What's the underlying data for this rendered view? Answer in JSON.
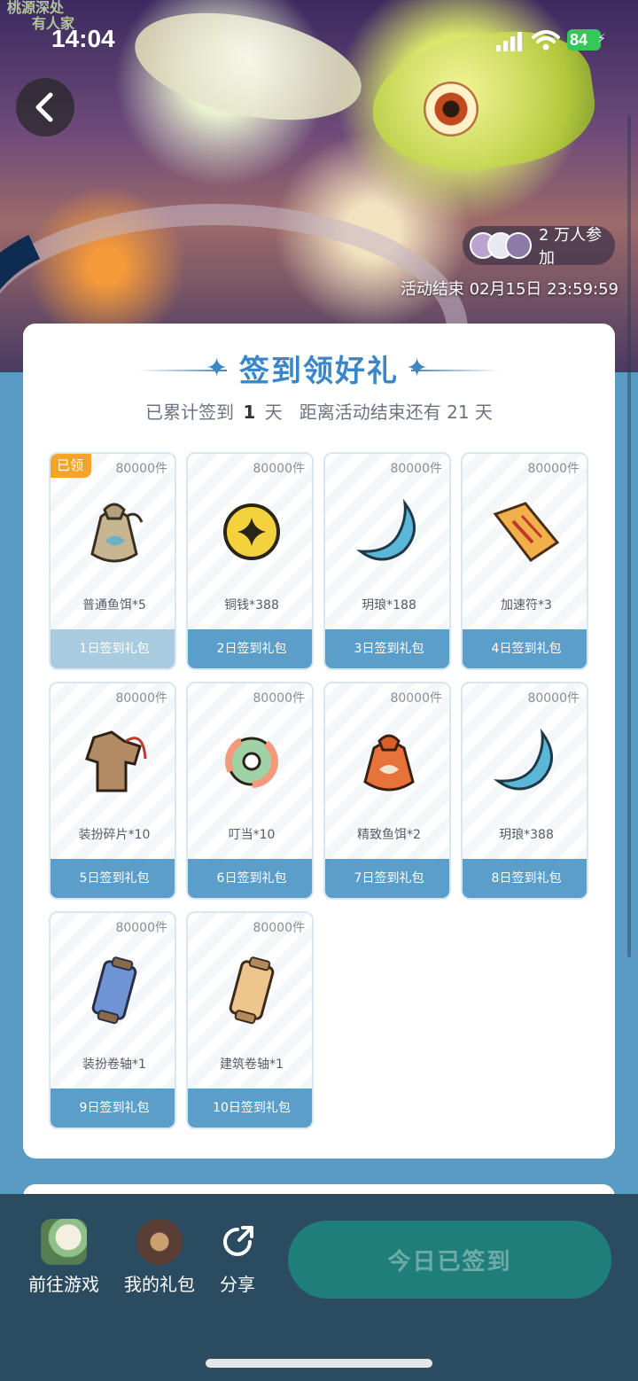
{
  "status_bar": {
    "time": "14:04",
    "battery": "84"
  },
  "hero": {
    "corner_text_line1": "桃源深处",
    "corner_text_line2": "有人家",
    "participants": "2 万人参加",
    "end_time": "活动结束 02月15日 23:59:59"
  },
  "card": {
    "title": "签到领好礼",
    "subtitle_prefix": "已累计签到",
    "subtitle_days": "1",
    "subtitle_unit": "天",
    "subtitle_suffix": "距离活动结束还有 21 天",
    "claimed_label": "已领",
    "rewards": [
      {
        "stock": "80000件",
        "name": "普通鱼饵*5",
        "pack": "1日签到礼包",
        "claimed": true,
        "icon": "bait-bag-icon"
      },
      {
        "stock": "80000件",
        "name": "铜钱*388",
        "pack": "2日签到礼包",
        "claimed": false,
        "icon": "coin-icon"
      },
      {
        "stock": "80000件",
        "name": "玥琅*188",
        "pack": "3日签到礼包",
        "claimed": false,
        "icon": "crescent-gem-icon"
      },
      {
        "stock": "80000件",
        "name": "加速符*3",
        "pack": "4日签到礼包",
        "claimed": false,
        "icon": "talisman-icon"
      },
      {
        "stock": "80000件",
        "name": "装扮碎片*10",
        "pack": "5日签到礼包",
        "claimed": false,
        "icon": "outfit-shard-icon"
      },
      {
        "stock": "80000件",
        "name": "叮当*10",
        "pack": "6日签到礼包",
        "claimed": false,
        "icon": "ring-coin-icon"
      },
      {
        "stock": "80000件",
        "name": "精致鱼饵*2",
        "pack": "7日签到礼包",
        "claimed": false,
        "icon": "fine-bait-bag-icon"
      },
      {
        "stock": "80000件",
        "name": "玥琅*388",
        "pack": "8日签到礼包",
        "claimed": false,
        "icon": "crescent-gem-icon"
      },
      {
        "stock": "80000件",
        "name": "装扮卷轴*1",
        "pack": "9日签到礼包",
        "claimed": false,
        "icon": "blue-scroll-icon"
      },
      {
        "stock": "80000件",
        "name": "建筑卷轴*1",
        "pack": "10日签到礼包",
        "claimed": false,
        "icon": "beige-scroll-icon"
      }
    ]
  },
  "bottom_bar": {
    "go_game": "前往游戏",
    "my_gifts": "我的礼包",
    "share": "分享",
    "checkin_button": "今日已签到"
  },
  "colors": {
    "accent_blue": "#3a86c8",
    "pack_label": "#5b9ec9",
    "pack_label_claimed": "#a9cbe0",
    "claimed_tag": "#f4a428",
    "checkin_button": "#207e7a",
    "bottom_bar": "#2a4b60"
  }
}
